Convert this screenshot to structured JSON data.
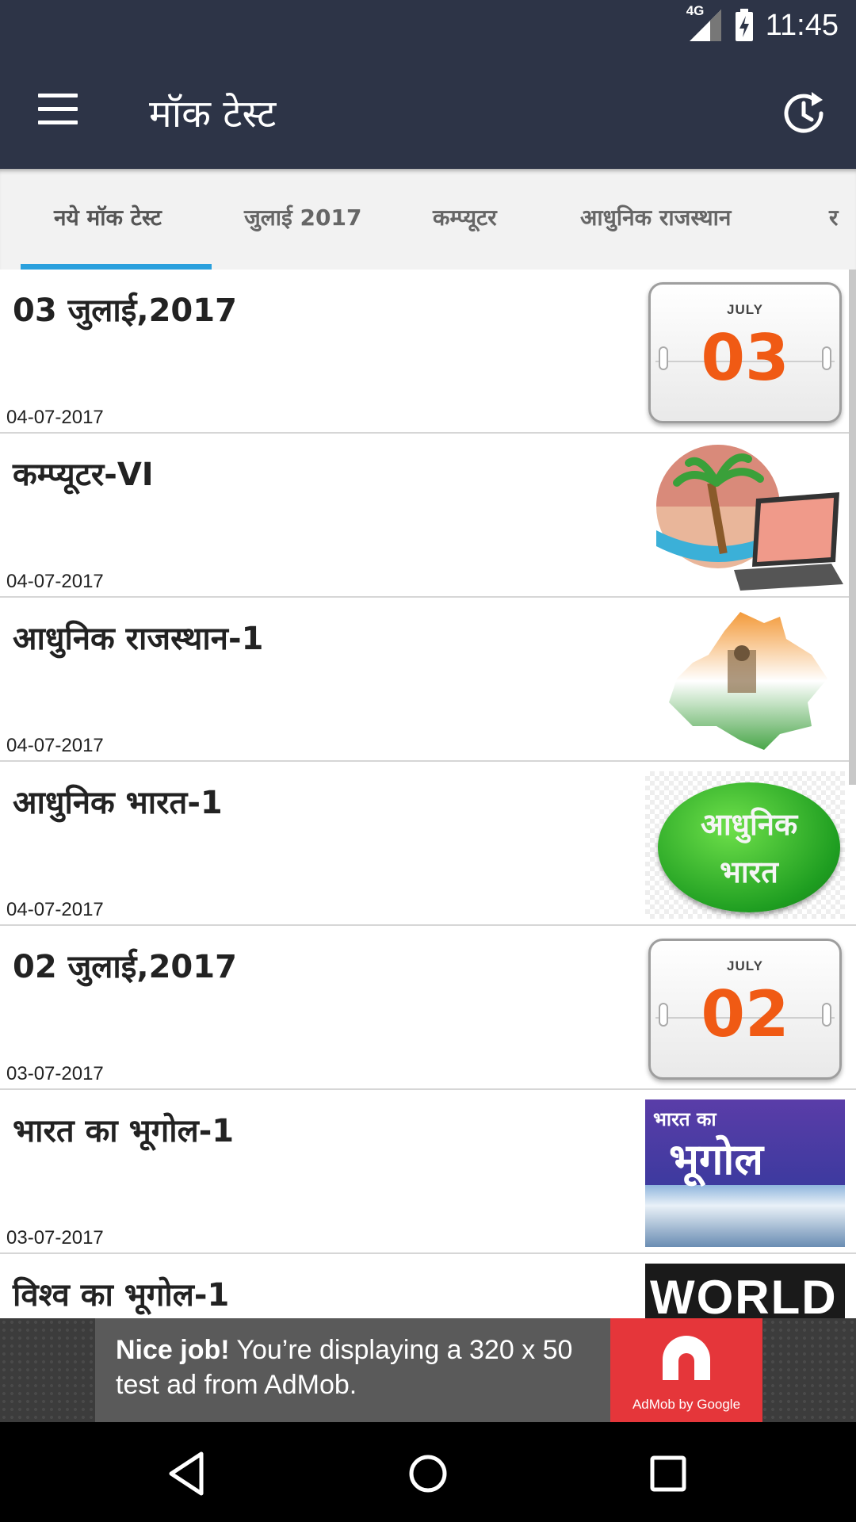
{
  "status": {
    "network": "4G",
    "time": "11:45"
  },
  "appbar": {
    "title": "मॉक टेस्ट"
  },
  "tabs": [
    {
      "label": "नये मॉक टेस्ट",
      "active": true
    },
    {
      "label": "जुलाई 2017"
    },
    {
      "label": "कम्प्यूटर"
    },
    {
      "label": "आधुनिक राजस्थान"
    },
    {
      "label": "र"
    }
  ],
  "items": [
    {
      "title": "03 जुलाई,2017",
      "date": "04-07-2017",
      "thumb": {
        "type": "calendar",
        "month": "JULY",
        "day": "03"
      }
    },
    {
      "title": "कम्प्यूटर-VI",
      "date": "04-07-2017",
      "thumb": {
        "type": "computer-icon"
      }
    },
    {
      "title": "आधुनिक राजस्थान-1",
      "date": "04-07-2017",
      "thumb": {
        "type": "rajasthan-map-icon"
      }
    },
    {
      "title": "आधुनिक भारत-1",
      "date": "04-07-2017",
      "thumb": {
        "type": "oval-label",
        "line1": "आधुनिक",
        "line2": "भारत"
      }
    },
    {
      "title": "02 जुलाई,2017",
      "date": "03-07-2017",
      "thumb": {
        "type": "calendar",
        "month": "JULY",
        "day": "02"
      }
    },
    {
      "title": "भारत का भूगोल-1",
      "date": "03-07-2017",
      "thumb": {
        "type": "book-cover",
        "line1": "भारत का",
        "line2": "भूगोल"
      }
    },
    {
      "title": "विश्व का भूगोल-1",
      "date": "",
      "thumb": {
        "type": "world-cover",
        "text": "WORLD"
      }
    }
  ],
  "ad": {
    "bold": "Nice job!",
    "text": " You’re displaying a 320 x 50 test ad from AdMob.",
    "logo_text": "AdMob by Google"
  },
  "colors": {
    "appbar": "#2d3447",
    "accent": "#2aa0dd",
    "calendar_digit": "#f05a14",
    "ad_red": "#e5363a"
  }
}
